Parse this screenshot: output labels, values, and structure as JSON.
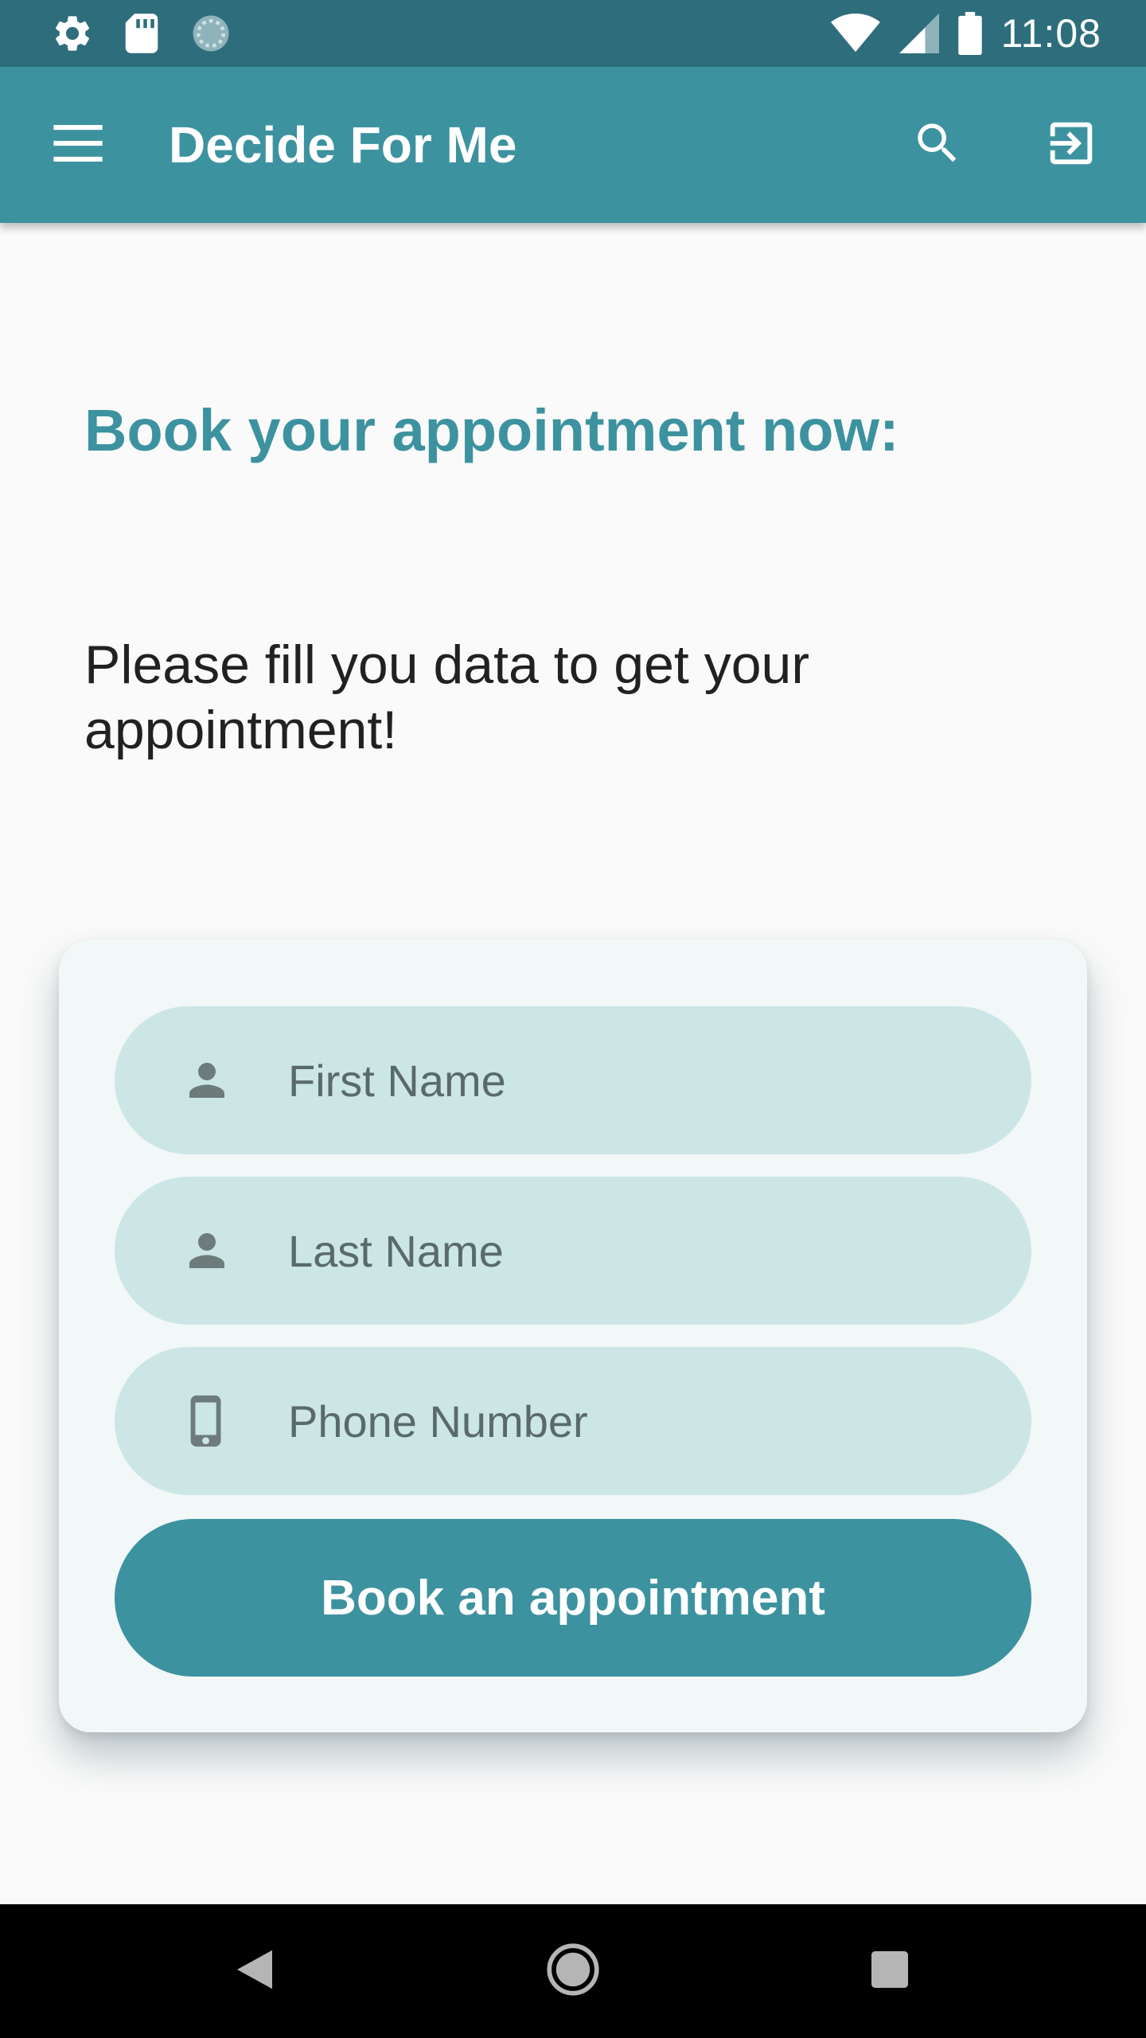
{
  "status_bar": {
    "time": "11:08",
    "left_icons": [
      "gear-icon",
      "sd-card-icon",
      "sync-icon"
    ],
    "right_icons": [
      "wifi-icon",
      "signal-icon",
      "battery-icon"
    ]
  },
  "app_bar": {
    "title": "Decide For Me",
    "menu_icon": "menu-icon",
    "search_icon": "search-icon",
    "logout_icon": "logout-icon"
  },
  "content": {
    "heading": "Book your appointment now:",
    "subtext": "Please fill you data to get your appointment!"
  },
  "form": {
    "first_name": {
      "placeholder": "First Name",
      "value": "",
      "icon": "person-icon"
    },
    "last_name": {
      "placeholder": "Last Name",
      "value": "",
      "icon": "person-icon"
    },
    "phone": {
      "placeholder": "Phone Number",
      "value": "",
      "icon": "phone-icon"
    },
    "submit_label": "Book an appointment"
  },
  "nav_bar": {
    "buttons": [
      "back",
      "home",
      "recents"
    ]
  },
  "colors": {
    "status_bar": "#2e6e7c",
    "primary": "#3d929f",
    "field_bg": "#cce6e6",
    "card_bg": "#f2f7f7",
    "page_bg": "#fafafa"
  }
}
